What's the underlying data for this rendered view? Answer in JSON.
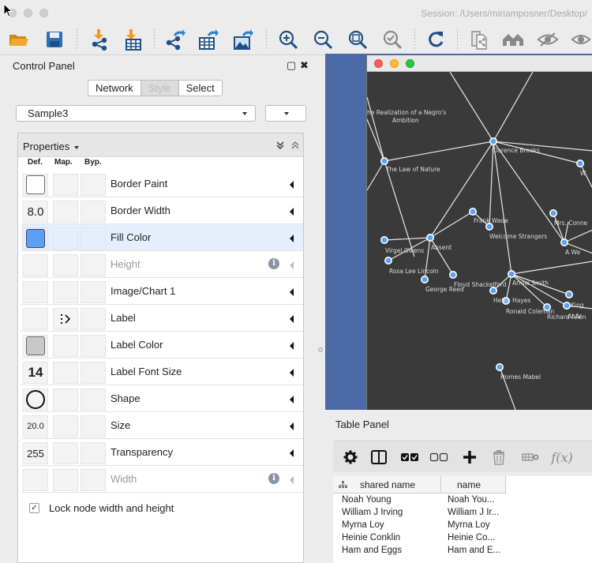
{
  "window": {
    "session_text": "Session: /Users/miriamposner/Desktop/"
  },
  "toolbar": {
    "icons": [
      "open-folder-icon",
      "save-icon",
      "import-network-icon",
      "import-table-icon",
      "share-network-icon",
      "share-table-icon",
      "share-image-icon",
      "zoom-in-icon",
      "zoom-out-icon",
      "zoom-fit-icon",
      "zoom-selected-icon",
      "refresh-icon",
      "new-network-view-icon",
      "home-icon",
      "hide-icon"
    ]
  },
  "control_panel": {
    "title": "Control Panel",
    "float_symbol": "▢",
    "close_symbol": "✖",
    "tabs": [
      {
        "label": "Network"
      },
      {
        "label": "Style"
      },
      {
        "label": "Select"
      }
    ],
    "style_select": "Sample3",
    "properties_label": "Properties",
    "columns": {
      "def": "Def.",
      "map": "Map.",
      "byp": "Byp."
    },
    "rows": [
      {
        "name": "Border Paint",
        "def": ""
      },
      {
        "name": "Border Width",
        "def": "8.0"
      },
      {
        "name": "Fill Color",
        "def": ""
      },
      {
        "name": "Height",
        "def": ""
      },
      {
        "name": "Image/Chart 1",
        "def": ""
      },
      {
        "name": "Label",
        "def": ""
      },
      {
        "name": "Label Color",
        "def": ""
      },
      {
        "name": "Label Font Size",
        "def": "14"
      },
      {
        "name": "Shape",
        "def": ""
      },
      {
        "name": "Size",
        "def": "20.0"
      },
      {
        "name": "Transparency",
        "def": "255"
      },
      {
        "name": "Width",
        "def": ""
      }
    ],
    "info_symbol": "i",
    "lock_label": "Lock node width and height",
    "check_symbol": "✓"
  },
  "network": {
    "labels": {
      "n1": "he Realization of a Negro's",
      "n1b": "Ambition",
      "n2": "The Law of Nature",
      "n3": "Clarence Brooks",
      "n4": "Frank Wade",
      "n5": "Welcome Strangers",
      "n6": "Virgel Owens",
      "n7": "Absent",
      "n8": "Rosa Lee Lincoln",
      "n9": "George Reed",
      "n10": "Floyd Shackelford",
      "n11": "Arrow Smith",
      "n12": "Helen Hayes",
      "n13": "Ronald Coleman",
      "n14": "Richard Allen",
      "n15": "Mrs. Conne",
      "n16": "A We",
      "n17": "Homes Mabel",
      "n18": "W",
      "n19": "King",
      "n20": "Al Ar"
    }
  },
  "table_panel": {
    "title": "Table Panel",
    "fx_label": "f(x)",
    "columns": [
      "shared name",
      "name"
    ],
    "rows": [
      [
        "Noah Young",
        "Noah You..."
      ],
      [
        "William J Irving",
        "William J Ir..."
      ],
      [
        "Myrna Loy",
        "Myrna Loy"
      ],
      [
        "Heinie Conklin",
        "Heinie Co..."
      ],
      [
        "Ham and Eggs",
        "Ham and E..."
      ]
    ]
  }
}
